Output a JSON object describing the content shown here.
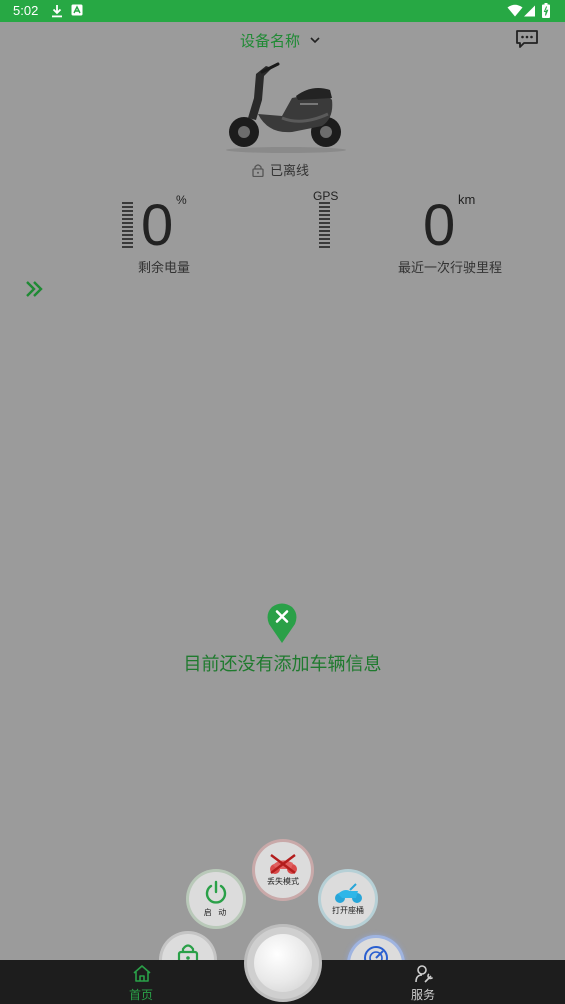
{
  "status_bar": {
    "time": "5:02"
  },
  "header": {
    "device_name": "设备名称"
  },
  "vehicle": {
    "connection_status": "已离线"
  },
  "metrics": {
    "battery": {
      "value": "0",
      "unit": "%",
      "label": "剩余电量"
    },
    "gps_label": "GPS",
    "mileage": {
      "value": "0",
      "unit": "km",
      "label": "最近一次行驶里程"
    }
  },
  "empty_state": {
    "message": "目前还没有添加车辆信息"
  },
  "quick_actions": {
    "lost_mode": "丢失模式",
    "start": "启 动",
    "open_seat": "打开座桶",
    "arm": "设 防",
    "self_check": "自 检"
  },
  "bottom_nav": {
    "home": "首页",
    "service": "服务"
  },
  "colors": {
    "accent": "#27a844",
    "accent_dark": "#1f8a34",
    "background": "#9b9b9b",
    "nav_bg": "#1d1d1d"
  }
}
